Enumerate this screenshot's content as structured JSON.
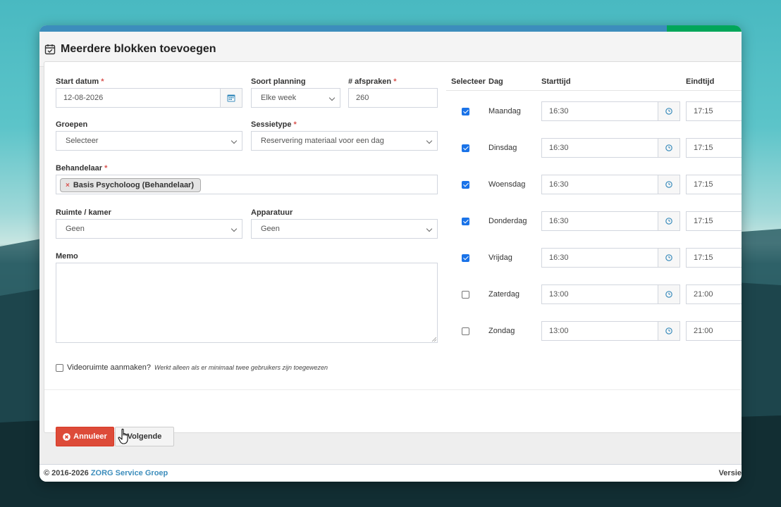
{
  "dialog": {
    "title": "Meerdere blokken toevoegen"
  },
  "form": {
    "start_date": {
      "label": "Start datum",
      "required": "*",
      "value": "12-08-2026"
    },
    "planning_type": {
      "label": "Soort planning",
      "value": "Elke week"
    },
    "appointments": {
      "label": "# afspraken",
      "required": "*",
      "value": "260"
    },
    "groups": {
      "label": "Groepen",
      "value": "Selecteer"
    },
    "session_type": {
      "label": "Sessietype",
      "required": "*",
      "value": "Reservering materiaal voor een dag"
    },
    "practitioner": {
      "label": "Behandelaar",
      "required": "*",
      "tag_remove": "×",
      "tag": "Basis Psycholoog (Behandelaar)"
    },
    "room": {
      "label": "Ruimte / kamer",
      "value": "Geen"
    },
    "equipment": {
      "label": "Apparatuur",
      "value": "Geen"
    },
    "memo": {
      "label": "Memo",
      "value": ""
    },
    "video_room": {
      "label": "Videoruimte aanmaken?",
      "hint": "Werkt alleen als er minimaal twee gebruikers zijn toegewezen",
      "checked": false
    }
  },
  "schedule": {
    "headers": {
      "select": "Selecteer",
      "day": "Dag",
      "start": "Starttijd",
      "end": "Eindtijd"
    },
    "rows": [
      {
        "checked": true,
        "day": "Maandag",
        "start": "16:30",
        "end": "17:15"
      },
      {
        "checked": true,
        "day": "Dinsdag",
        "start": "16:30",
        "end": "17:15"
      },
      {
        "checked": true,
        "day": "Woensdag",
        "start": "16:30",
        "end": "17:15"
      },
      {
        "checked": true,
        "day": "Donderdag",
        "start": "16:30",
        "end": "17:15"
      },
      {
        "checked": true,
        "day": "Vrijdag",
        "start": "16:30",
        "end": "17:15"
      },
      {
        "checked": false,
        "day": "Zaterdag",
        "start": "13:00",
        "end": "21:00"
      },
      {
        "checked": false,
        "day": "Zondag",
        "start": "13:00",
        "end": "21:00"
      }
    ]
  },
  "buttons": {
    "cancel": "Annuleer",
    "next": "Volgende"
  },
  "footer": {
    "copyright": "© 2016-2026",
    "brand": "ZORG Service Groep",
    "version": "Versie"
  },
  "colors": {
    "primary": "#3c8dbc",
    "success": "#00a65a",
    "danger": "#dd4b39",
    "checkbox": "#1a73e8"
  }
}
